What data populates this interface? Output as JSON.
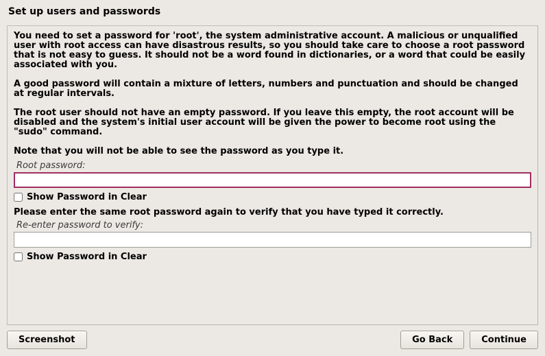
{
  "title": "Set up users and passwords",
  "paragraphs": {
    "p1": "You need to set a password for 'root', the system administrative account. A malicious or unqualified user with root access can have disastrous results, so you should take care to choose a root password that is not easy to guess. It should not be a word found in dictionaries, or a word that could be easily associated with you.",
    "p2": "A good password will contain a mixture of letters, numbers and punctuation and should be changed at regular intervals.",
    "p3": "The root user should not have an empty password. If you leave this empty, the root account will be disabled and the system's initial user account will be given the power to become root using the \"sudo\" command.",
    "note": "Note that you will not be able to see the password as you type it."
  },
  "fields": {
    "root_password_label": "Root password:",
    "root_password_value": "",
    "show_clear_1": "Show Password in Clear",
    "verify_heading": "Please enter the same root password again to verify that you have typed it correctly.",
    "verify_label": "Re-enter password to verify:",
    "verify_value": "",
    "show_clear_2": "Show Password in Clear"
  },
  "buttons": {
    "screenshot": "Screenshot",
    "go_back": "Go Back",
    "continue": "Continue"
  }
}
